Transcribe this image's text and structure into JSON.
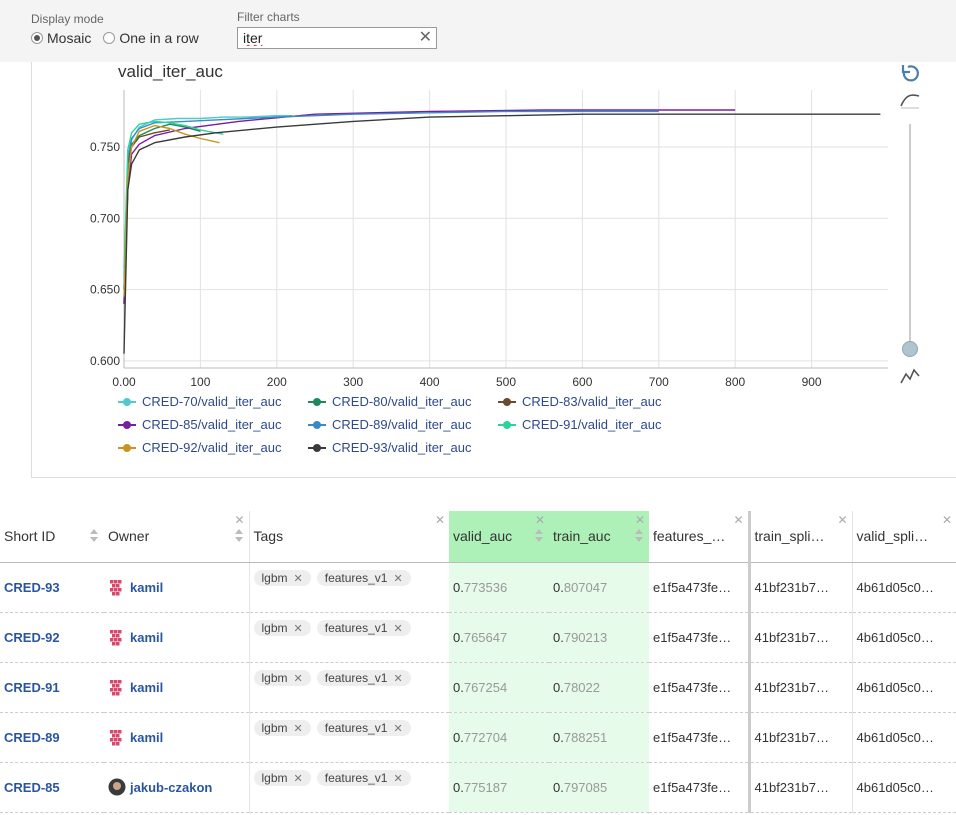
{
  "controls": {
    "display_mode_label": "Display mode",
    "mode_options": [
      "Mosaic",
      "One in a row"
    ],
    "selected_mode": "Mosaic",
    "filter_label": "Filter charts",
    "filter_value": "iter"
  },
  "chart": {
    "title": "valid_iter_auc",
    "y_ticks": [
      "0.600",
      "0.650",
      "0.700",
      "0.750"
    ],
    "x_ticks": [
      "0.00",
      "100",
      "200",
      "300",
      "400",
      "500",
      "600",
      "700",
      "800",
      "900"
    ]
  },
  "chart_data": {
    "type": "line",
    "title": "valid_iter_auc",
    "xlabel": "",
    "ylabel": "",
    "xlim": [
      0,
      1000
    ],
    "ylim": [
      0.595,
      0.79
    ],
    "grid": true,
    "legend_position": "bottom",
    "series": [
      {
        "name": "CRED-70/valid_iter_auc",
        "color": "#4fc9c9",
        "x": [
          0,
          5,
          10,
          20,
          40,
          70,
          100,
          130,
          160,
          200,
          220
        ],
        "y": [
          0.665,
          0.735,
          0.755,
          0.764,
          0.769,
          0.77,
          0.77,
          0.771,
          0.771,
          0.772,
          0.772
        ]
      },
      {
        "name": "CRED-80/valid_iter_auc",
        "color": "#1a8a5a",
        "x": [
          0,
          5,
          10,
          20,
          40,
          60,
          80,
          100
        ],
        "y": [
          0.65,
          0.74,
          0.752,
          0.758,
          0.763,
          0.766,
          0.764,
          0.761
        ]
      },
      {
        "name": "CRED-83/valid_iter_auc",
        "color": "#6b4a2e",
        "x": [
          0,
          5,
          10,
          20,
          40,
          60
        ],
        "y": [
          0.64,
          0.738,
          0.75,
          0.757,
          0.76,
          0.762
        ]
      },
      {
        "name": "CRED-85/valid_iter_auc",
        "color": "#7a1ea0",
        "x": [
          0,
          5,
          10,
          20,
          40,
          80,
          150,
          250,
          400,
          550,
          700,
          800
        ],
        "y": [
          0.64,
          0.72,
          0.745,
          0.752,
          0.758,
          0.763,
          0.768,
          0.773,
          0.775,
          0.776,
          0.776,
          0.776
        ]
      },
      {
        "name": "CRED-89/valid_iter_auc",
        "color": "#3a8ac4",
        "x": [
          0,
          5,
          10,
          20,
          40,
          80,
          120,
          160,
          200,
          250,
          300,
          400,
          500,
          600,
          700
        ],
        "y": [
          0.65,
          0.742,
          0.756,
          0.763,
          0.767,
          0.768,
          0.769,
          0.77,
          0.771,
          0.772,
          0.773,
          0.774,
          0.775,
          0.775,
          0.775
        ]
      },
      {
        "name": "CRED-91/valid_iter_auc",
        "color": "#2ad49a",
        "x": [
          0,
          5,
          10,
          20,
          40,
          60,
          80,
          100,
          120,
          130
        ],
        "y": [
          0.66,
          0.748,
          0.76,
          0.766,
          0.768,
          0.767,
          0.765,
          0.762,
          0.76,
          0.759
        ]
      },
      {
        "name": "CRED-92/valid_iter_auc",
        "color": "#c8961e",
        "x": [
          0,
          5,
          10,
          20,
          40,
          60,
          80,
          100,
          125
        ],
        "y": [
          0.645,
          0.728,
          0.75,
          0.761,
          0.765,
          0.763,
          0.759,
          0.756,
          0.753
        ]
      },
      {
        "name": "CRED-93/valid_iter_auc",
        "color": "#3a3a3a",
        "x": [
          0,
          5,
          10,
          20,
          40,
          80,
          120,
          160,
          200,
          300,
          400,
          500,
          600,
          700,
          800,
          900,
          990
        ],
        "y": [
          0.605,
          0.72,
          0.738,
          0.748,
          0.753,
          0.757,
          0.76,
          0.762,
          0.764,
          0.768,
          0.771,
          0.772,
          0.773,
          0.773,
          0.773,
          0.773,
          0.773
        ]
      }
    ]
  },
  "table": {
    "headers": [
      "Short ID",
      "Owner",
      "Tags",
      "valid_auc",
      "train_auc",
      "features_…",
      "train_spli…",
      "valid_spli…"
    ],
    "rows": [
      {
        "id": "CRED-93",
        "owner": "kamil",
        "avatar": "pattern",
        "tags": [
          "lgbm",
          "features_v1"
        ],
        "valid_lead": "0.",
        "valid_rest": "773536",
        "train_lead": "0.",
        "train_rest": "807047",
        "features": "e1f5a473fe…",
        "train_split": "41bf231b7…",
        "valid_split": "4b61d05c0…"
      },
      {
        "id": "CRED-92",
        "owner": "kamil",
        "avatar": "pattern",
        "tags": [
          "lgbm",
          "features_v1"
        ],
        "valid_lead": "0.",
        "valid_rest": "765647",
        "train_lead": "0.",
        "train_rest": "790213",
        "features": "e1f5a473fe…",
        "train_split": "41bf231b7…",
        "valid_split": "4b61d05c0…"
      },
      {
        "id": "CRED-91",
        "owner": "kamil",
        "avatar": "pattern",
        "tags": [
          "lgbm",
          "features_v1"
        ],
        "valid_lead": "0.",
        "valid_rest": "767254",
        "train_lead": "0.",
        "train_rest": "78022",
        "features": "e1f5a473fe…",
        "train_split": "41bf231b7…",
        "valid_split": "4b61d05c0…"
      },
      {
        "id": "CRED-89",
        "owner": "kamil",
        "avatar": "pattern",
        "tags": [
          "lgbm",
          "features_v1"
        ],
        "valid_lead": "0.",
        "valid_rest": "772704",
        "train_lead": "0.",
        "train_rest": "788251",
        "features": "e1f5a473fe…",
        "train_split": "41bf231b7…",
        "valid_split": "4b61d05c0…"
      },
      {
        "id": "CRED-85",
        "owner": "jakub-czakon",
        "avatar": "photo",
        "tags": [
          "lgbm",
          "features_v1"
        ],
        "valid_lead": "0.",
        "valid_rest": "775187",
        "train_lead": "0.",
        "train_rest": "797085",
        "features": "e1f5a473fe…",
        "train_split": "41bf231b7…",
        "valid_split": "4b61d05c0…"
      }
    ]
  }
}
